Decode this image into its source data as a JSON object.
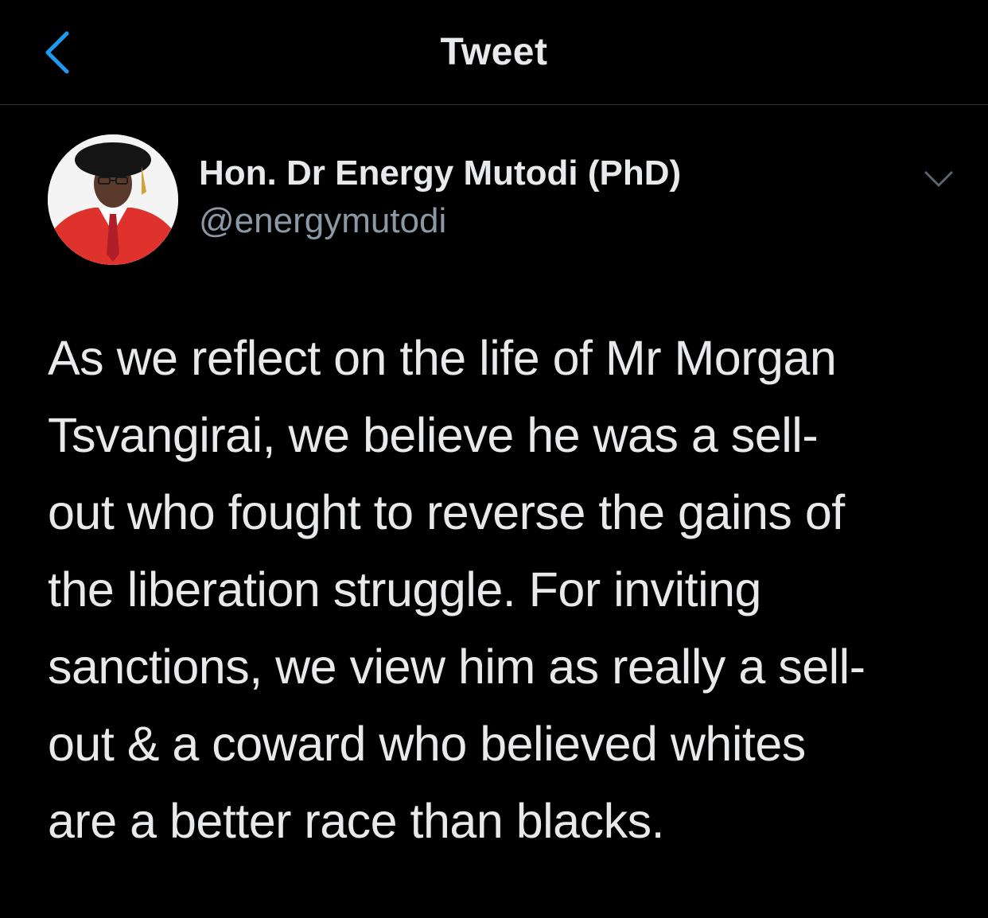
{
  "colors": {
    "background": "#000000",
    "accent": "#1d9bf0",
    "text_primary": "#e7e9ea",
    "text_secondary": "#8b98a5",
    "divider": "#2f3336"
  },
  "nav": {
    "back_icon": "chevron-left-icon",
    "title": "Tweet"
  },
  "tweet": {
    "author": {
      "display_name": "Hon. Dr Energy Mutodi (PhD)",
      "handle": "@energymutodi"
    },
    "more_icon": "chevron-down-icon",
    "text_lines": [
      "As we reflect on the life of Mr Morgan",
      "Tsvangirai, we believe he was a sell-",
      "out who fought to reverse the gains of",
      "the liberation struggle. For inviting",
      "sanctions, we view him as really a sell-",
      "out & a coward who believed whites",
      "are a better race than blacks."
    ]
  }
}
